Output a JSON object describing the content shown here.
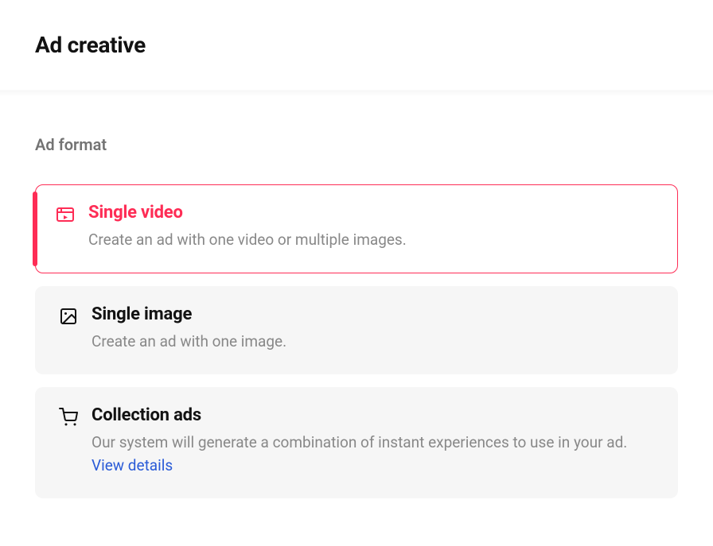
{
  "header": {
    "title": "Ad creative"
  },
  "section": {
    "label": "Ad format"
  },
  "options": {
    "single_video": {
      "title": "Single video",
      "desc": "Create an ad with one video or multiple images."
    },
    "single_image": {
      "title": "Single image",
      "desc": "Create an ad with one image."
    },
    "collection": {
      "title": "Collection ads",
      "desc_part1": "Our system will generate a combination of instant experiences to use in your ad. ",
      "link": "View details"
    }
  }
}
